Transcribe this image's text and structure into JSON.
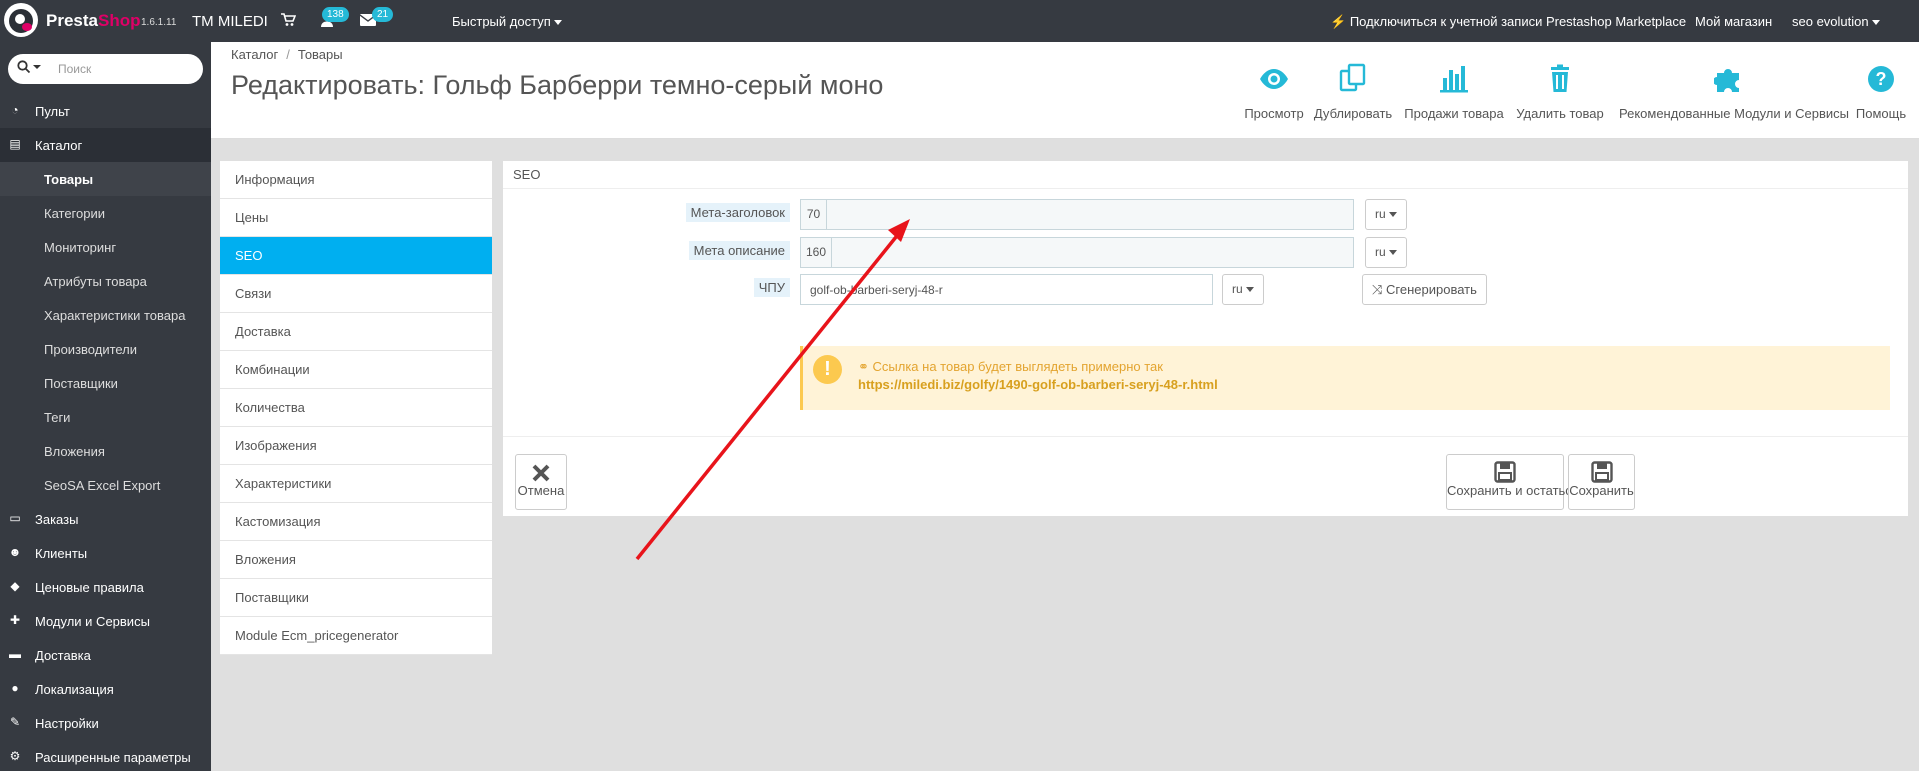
{
  "topbar": {
    "brand_presta": "Presta",
    "brand_shop": "Shop",
    "version": "1.6.1.11",
    "shop_name": "TM MILEDI",
    "notifications_count": "138",
    "messages_count": "21",
    "quick_access": "Быстрый доступ",
    "marketplace": "Подключиться к учетной записи Prestashop Marketplace",
    "my_shop": "Мой магазин",
    "user": "seo evolution"
  },
  "sidebar": {
    "search_placeholder": "Поиск",
    "items": [
      {
        "label": "Пульт",
        "icon": "dashboard-icon"
      },
      {
        "label": "Каталог",
        "icon": "book-icon"
      },
      {
        "label": "Заказы",
        "icon": "credit-card-icon"
      },
      {
        "label": "Клиенты",
        "icon": "users-icon"
      },
      {
        "label": "Ценовые правила",
        "icon": "tag-icon"
      },
      {
        "label": "Модули и Сервисы",
        "icon": "puzzle-icon"
      },
      {
        "label": "Доставка",
        "icon": "truck-icon"
      },
      {
        "label": "Локализация",
        "icon": "globe-icon"
      },
      {
        "label": "Настройки",
        "icon": "wrench-icon"
      },
      {
        "label": "Расширенные параметры",
        "icon": "cogs-icon"
      }
    ],
    "catalog_subitems": [
      "Товары",
      "Категории",
      "Мониторинг",
      "Атрибуты товара",
      "Характеристики товара",
      "Производители",
      "Поставщики",
      "Теги",
      "Вложения",
      "SeoSA Excel Export"
    ]
  },
  "breadcrumb": {
    "level1": "Каталог",
    "separator": "/",
    "level2": "Товары"
  },
  "page_title": "Редактировать: Гольф Барберри темно-серый моно",
  "toolbar": {
    "preview": "Просмотр",
    "duplicate": "Дублировать",
    "sales": "Продажи товара",
    "delete": "Удалить товар",
    "recommended": "Рекомендованные Модули и Сервисы",
    "help": "Помощь"
  },
  "tabs": [
    "Информация",
    "Цены",
    "SEO",
    "Связи",
    "Доставка",
    "Комбинации",
    "Количества",
    "Изображения",
    "Характеристики",
    "Кастомизация",
    "Вложения",
    "Поставщики",
    "Module Ecm_pricegenerator"
  ],
  "seo": {
    "panel_title": "SEO",
    "meta_title_label": "Мета-заголовок",
    "meta_title_counter": "70",
    "meta_title_value": "",
    "meta_desc_label": "Мета описание",
    "meta_desc_counter": "160",
    "meta_desc_value": "",
    "friendly_url_label": "ЧПУ",
    "friendly_url_value": "golf-ob-barberi-seryj-48-r",
    "lang": "ru",
    "generate": "Сгенерировать",
    "alert_message": "Ссылка на товар будет выглядеть примерно так",
    "alert_url": "https://miledi.biz/golfy/1490-golf-ob-barberi-seryj-48-r.html",
    "cancel": "Отмена",
    "save_stay": "Сохранить и остаться",
    "save": "Сохранить"
  },
  "colors": {
    "topbar": "#363a41",
    "accent": "#00aff0",
    "badge": "#25b9d7",
    "warning": "#fcc94f",
    "arrow": "#e8141b"
  }
}
